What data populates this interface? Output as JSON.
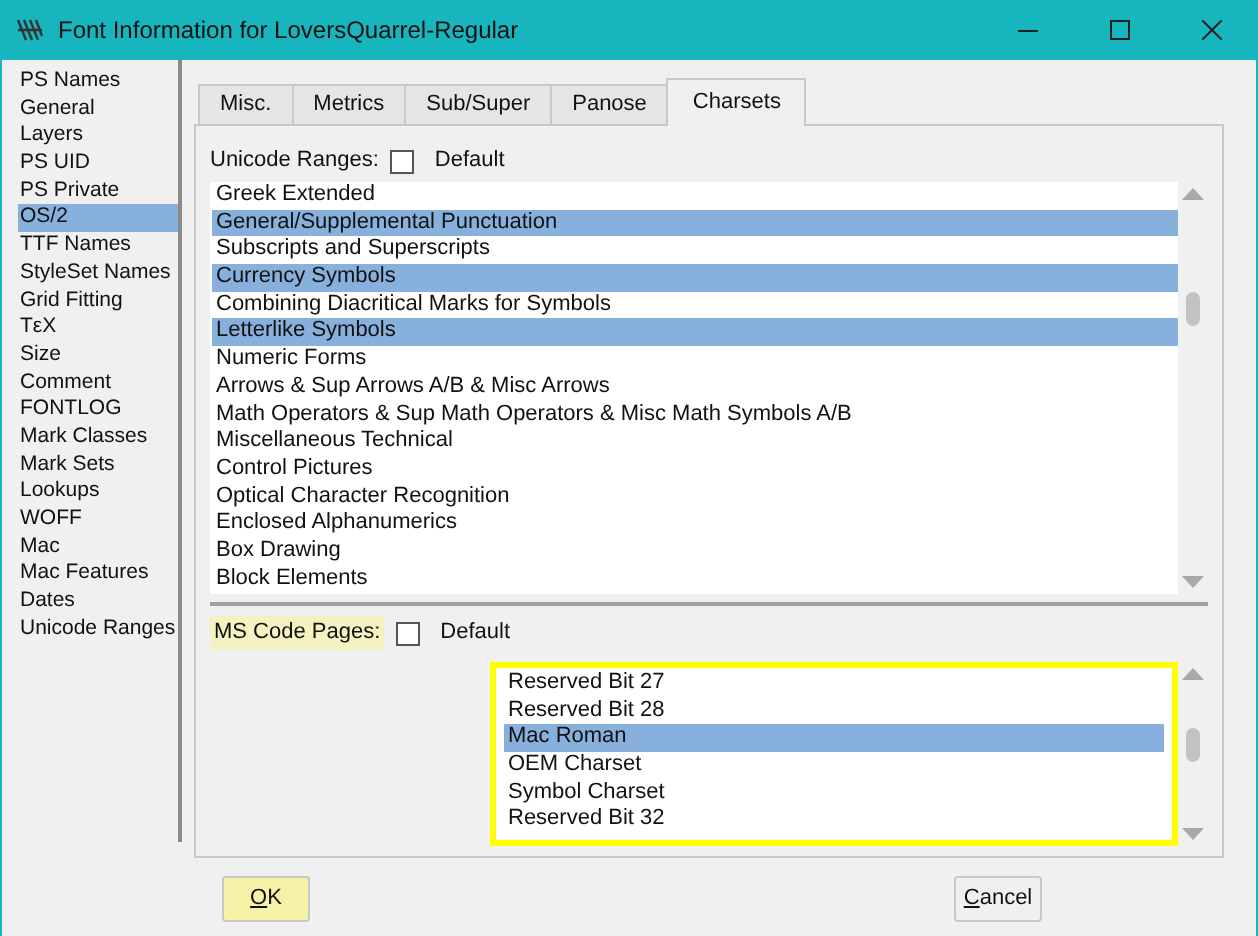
{
  "window": {
    "title": "Font Information for LoversQuarrel-Regular"
  },
  "sidebar": {
    "items": [
      {
        "label": "PS Names",
        "selected": false
      },
      {
        "label": "General",
        "selected": false
      },
      {
        "label": "Layers",
        "selected": false
      },
      {
        "label": "PS UID",
        "selected": false
      },
      {
        "label": "PS Private",
        "selected": false
      },
      {
        "label": "OS/2",
        "selected": true
      },
      {
        "label": "TTF Names",
        "selected": false
      },
      {
        "label": "StyleSet Names",
        "selected": false
      },
      {
        "label": "Grid Fitting",
        "selected": false
      },
      {
        "label": "TεX",
        "selected": false
      },
      {
        "label": "Size",
        "selected": false
      },
      {
        "label": "Comment",
        "selected": false
      },
      {
        "label": "FONTLOG",
        "selected": false
      },
      {
        "label": "Mark Classes",
        "selected": false
      },
      {
        "label": "Mark Sets",
        "selected": false
      },
      {
        "label": "Lookups",
        "selected": false
      },
      {
        "label": "WOFF",
        "selected": false
      },
      {
        "label": "Mac",
        "selected": false
      },
      {
        "label": "Mac Features",
        "selected": false
      },
      {
        "label": "Dates",
        "selected": false
      },
      {
        "label": "Unicode Ranges",
        "selected": false
      }
    ]
  },
  "tabs": [
    {
      "label": "Misc.",
      "selected": false
    },
    {
      "label": "Metrics",
      "selected": false
    },
    {
      "label": "Sub/Super",
      "selected": false
    },
    {
      "label": "Panose",
      "selected": false
    },
    {
      "label": "Charsets",
      "selected": true
    }
  ],
  "unicode_ranges": {
    "label": "Unicode Ranges:",
    "default_checkbox": {
      "label": "Default",
      "checked": false
    },
    "items": [
      {
        "label": "Greek Extended",
        "selected": false
      },
      {
        "label": "General/Supplemental Punctuation",
        "selected": true
      },
      {
        "label": "Subscripts and Superscripts",
        "selected": false
      },
      {
        "label": "Currency Symbols",
        "selected": true
      },
      {
        "label": "Combining Diacritical Marks for Symbols",
        "selected": false
      },
      {
        "label": "Letterlike Symbols",
        "selected": true
      },
      {
        "label": "Numeric Forms",
        "selected": false
      },
      {
        "label": "Arrows & Sup Arrows A/B & Misc Arrows",
        "selected": false
      },
      {
        "label": "Math Operators & Sup Math Operators & Misc Math Symbols A/B",
        "selected": false
      },
      {
        "label": "Miscellaneous Technical",
        "selected": false
      },
      {
        "label": "Control Pictures",
        "selected": false
      },
      {
        "label": "Optical Character Recognition",
        "selected": false
      },
      {
        "label": "Enclosed Alphanumerics",
        "selected": false
      },
      {
        "label": "Box Drawing",
        "selected": false
      },
      {
        "label": "Block Elements",
        "selected": false
      }
    ]
  },
  "ms_code_pages": {
    "label": "MS Code Pages:",
    "highlighted": true,
    "default_checkbox": {
      "label": "Default",
      "checked": false
    },
    "focused": true,
    "items": [
      {
        "label": "Reserved Bit 27",
        "selected": false
      },
      {
        "label": "Reserved Bit 28",
        "selected": false
      },
      {
        "label": "Mac Roman",
        "selected": true
      },
      {
        "label": "OEM Charset",
        "selected": false
      },
      {
        "label": "Symbol Charset",
        "selected": false
      },
      {
        "label": "Reserved Bit 32",
        "selected": false
      }
    ]
  },
  "buttons": [
    {
      "label": "OK",
      "default": true
    },
    {
      "label": "Cancel",
      "default": false
    }
  ]
}
